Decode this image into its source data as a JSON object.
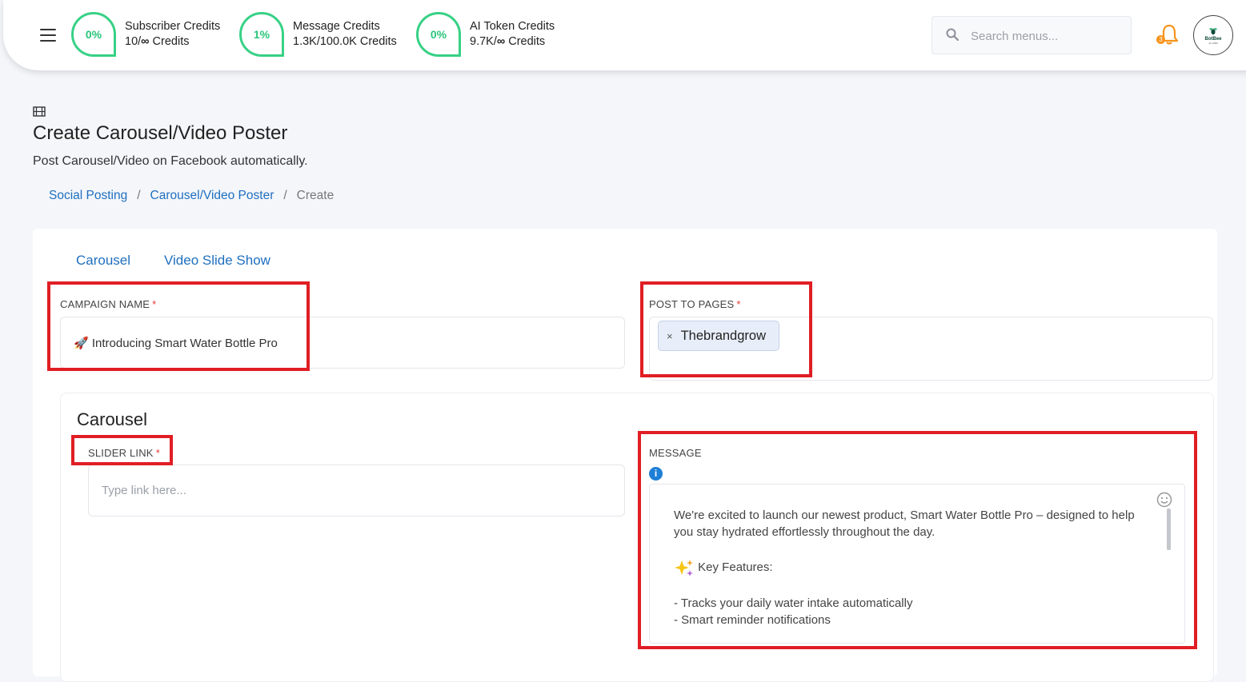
{
  "topbar": {
    "credits": [
      {
        "percent": "0%",
        "label": "Subscriber Credits",
        "used": "10/",
        "total_symbol": "∞",
        "suffix": " Credits"
      },
      {
        "percent": "1%",
        "label": "Message Credits",
        "used": "1.3K/100.0K",
        "total_symbol": "",
        "suffix": " Credits"
      },
      {
        "percent": "0%",
        "label": "AI Token Credits",
        "used": "9.7K/",
        "total_symbol": "∞",
        "suffix": " Credits"
      }
    ],
    "search_placeholder": "Search menus...",
    "notification_count": "3",
    "avatar": {
      "text": "BotBee",
      "subtext": "AI LABS"
    }
  },
  "page": {
    "title": "Create Carousel/Video Poster",
    "subtitle": "Post Carousel/Video on Facebook automatically.",
    "breadcrumb": [
      {
        "label": "Social Posting"
      },
      {
        "label": "Carousel/Video Poster"
      },
      {
        "label": "Create"
      }
    ]
  },
  "tabs": [
    {
      "label": "Carousel"
    },
    {
      "label": "Video Slide Show"
    }
  ],
  "form": {
    "campaign_name": {
      "label": "CAMPAIGN NAME",
      "required_mark": "*",
      "value": "🚀 Introducing Smart Water Bottle Pro"
    },
    "post_to_pages": {
      "label": "POST TO PAGES",
      "required_mark": "*",
      "tags": [
        "Thebrandgrow"
      ],
      "remove_symbol": "×"
    },
    "carousel_section": {
      "title": "Carousel",
      "slider_link": {
        "label": "SLIDER LINK",
        "required_mark": "*",
        "placeholder": "Type link here..."
      },
      "message": {
        "label": "MESSAGE",
        "info_symbol": "i",
        "lines": [
          "We're excited to launch our newest product, Smart Water Bottle Pro – designed to help you stay hydrated effortlessly throughout the day.",
          "Key Features:",
          "- Tracks your daily water intake automatically",
          "- Smart reminder notifications"
        ]
      }
    }
  },
  "colors": {
    "accent_green": "#37d185",
    "link_blue": "#1f6fbf",
    "highlight_red": "#e01e24",
    "required_red": "#e53935",
    "badge_orange": "#f7941d"
  }
}
